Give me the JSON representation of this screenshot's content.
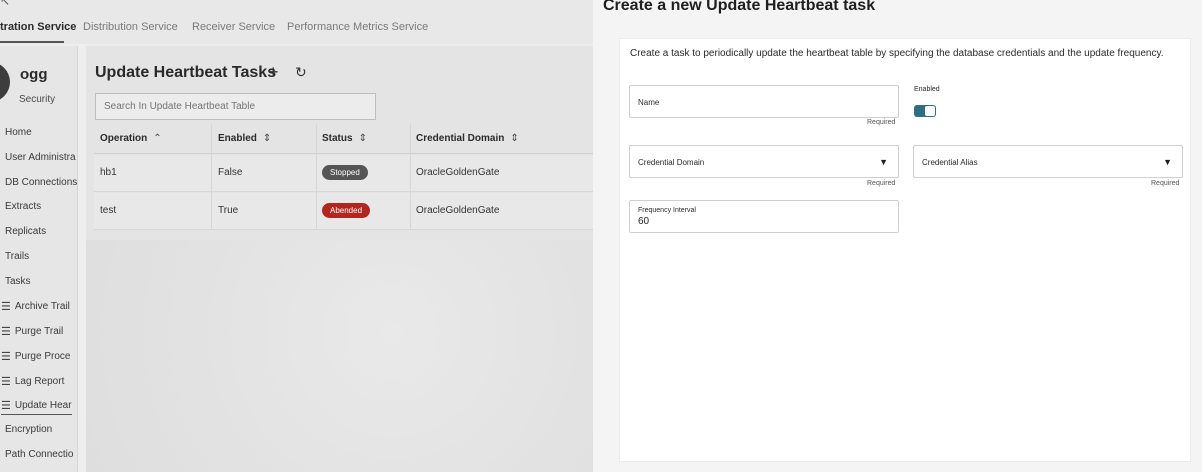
{
  "top_tabs": [
    {
      "label": "tration Service",
      "active": true
    },
    {
      "label": "Distribution Service",
      "active": false
    },
    {
      "label": "Receiver Service",
      "active": false
    },
    {
      "label": "Performance Metrics Service",
      "active": false
    }
  ],
  "user": {
    "name": "ogg",
    "role": "Security"
  },
  "sidebar": {
    "items": [
      {
        "label": "Home",
        "icon": ""
      },
      {
        "label": "User Administra",
        "icon": ""
      },
      {
        "label": "DB Connections",
        "icon": ""
      },
      {
        "label": "Extracts",
        "icon": ""
      },
      {
        "label": "Replicats",
        "icon": ""
      },
      {
        "label": "Trails",
        "icon": ""
      },
      {
        "label": "Tasks",
        "icon": ""
      },
      {
        "label": "Archive Trail",
        "icon": "list-icon"
      },
      {
        "label": "Purge Trail",
        "icon": "list-icon"
      },
      {
        "label": "Purge Proce",
        "icon": "list-icon"
      },
      {
        "label": "Lag Report",
        "icon": "list-icon"
      },
      {
        "label": "Update Hear",
        "icon": "list-icon"
      },
      {
        "label": "Encryption",
        "icon": ""
      },
      {
        "label": "Path Connectio",
        "icon": ""
      }
    ]
  },
  "main": {
    "title": "Update Heartbeat Tasks",
    "search_placeholder": "Search In Update Heartbeat Table",
    "columns": [
      "Operation",
      "Enabled",
      "Status",
      "Credential Domain"
    ],
    "rows": [
      {
        "operation": "hb1",
        "enabled": "False",
        "status": "Stopped",
        "status_color": "#555555",
        "credential_domain": "OracleGoldenGate"
      },
      {
        "operation": "test",
        "enabled": "True",
        "status": "Abended",
        "status_color": "#b3261e",
        "credential_domain": "OracleGoldenGate"
      }
    ]
  },
  "dialog": {
    "title": "Create a new Update Heartbeat task",
    "description": "Create a task to periodically update the heartbeat table by specifying the database credentials and the update frequency.",
    "name_label": "Name",
    "name_required": "Required",
    "enabled_label": "Enabled",
    "enabled_value": true,
    "credential_domain_label": "Credential Domain",
    "credential_domain_required": "Required",
    "credential_alias_label": "Credential Alias",
    "credential_alias_required": "Required",
    "frequency_label": "Frequency Interval",
    "frequency_value": "60",
    "accent_color": "#2f6e82"
  }
}
